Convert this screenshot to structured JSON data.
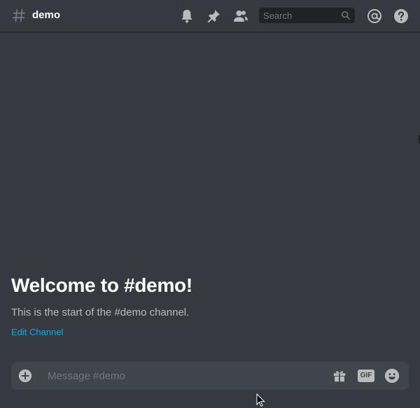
{
  "header": {
    "channel_name": "demo",
    "search_placeholder": "Search",
    "icons": [
      "hash-icon",
      "bell-icon",
      "pin-icon",
      "members-icon",
      "search-icon",
      "mention-icon",
      "help-icon"
    ]
  },
  "welcome": {
    "title": "Welcome to #demo!",
    "subtitle": "This is the start of the #demo channel.",
    "edit_link": "Edit Channel"
  },
  "composer": {
    "placeholder": "Message #demo",
    "gif_label": "GIF",
    "icons": [
      "add-icon",
      "gift-icon",
      "emoji-icon"
    ]
  },
  "colors": {
    "background": "#36393f",
    "composer": "#40444b",
    "link": "#00b0f4",
    "icon": "#b9bbbe",
    "muted": "#72767d"
  }
}
